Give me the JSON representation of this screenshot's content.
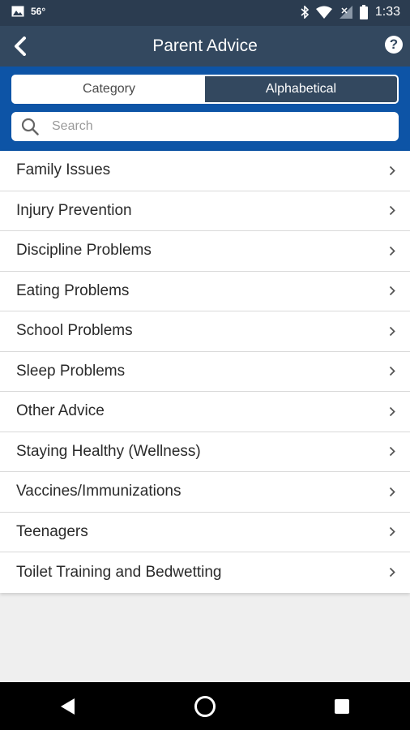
{
  "status_bar": {
    "temperature": "56°",
    "time": "1:33",
    "icons": [
      "image-icon",
      "bluetooth-icon",
      "wifi-icon",
      "signal-icon",
      "battery-icon"
    ]
  },
  "app_bar": {
    "title": "Parent Advice",
    "back_icon": "chevron-left-icon",
    "help_label": "?"
  },
  "tabs": {
    "category": "Category",
    "alphabetical": "Alphabetical",
    "active": "Alphabetical"
  },
  "search": {
    "placeholder": "Search",
    "value": ""
  },
  "list": {
    "items": [
      "Family Issues",
      "Injury Prevention",
      "Discipline Problems",
      "Eating Problems",
      "School Problems",
      "Sleep Problems",
      "Other Advice",
      "Staying Healthy (Wellness)",
      "Vaccines/Immunizations",
      "Teenagers",
      "Toilet Training and Bedwetting"
    ]
  },
  "colors": {
    "status_bar": "#2b3c50",
    "app_bar": "#33485f",
    "controls_bg": "#0d54a6",
    "background": "#efefef"
  },
  "nav_bar": {
    "icons": [
      "back-triangle-icon",
      "home-circle-icon",
      "recents-square-icon"
    ]
  }
}
